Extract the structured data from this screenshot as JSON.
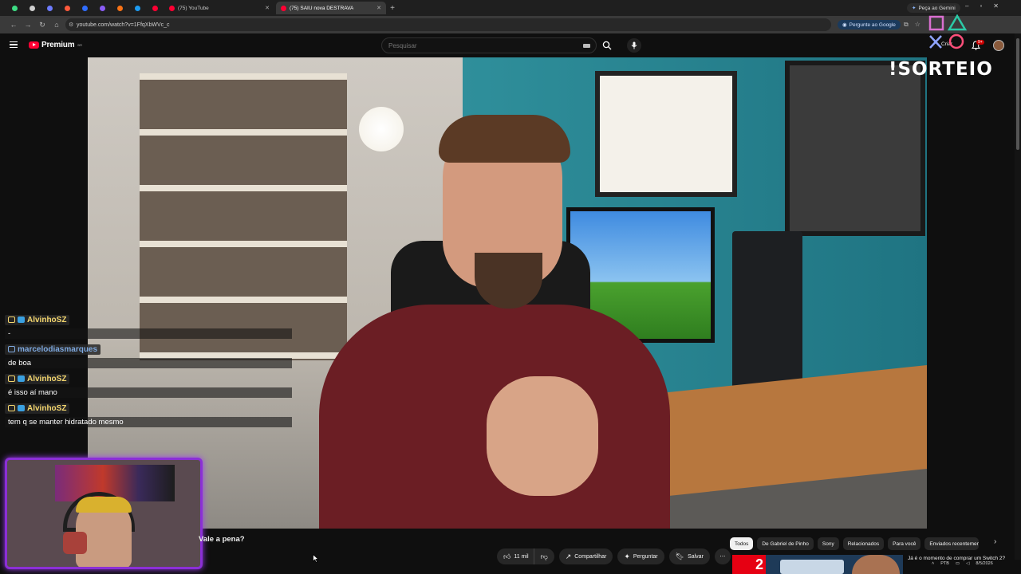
{
  "browser": {
    "tabs": [
      {
        "label": "",
        "color": "#3ddc84"
      },
      {
        "label": "",
        "color": "#cfcfcf"
      },
      {
        "label": "",
        "color": "#6d7cff"
      },
      {
        "label": "",
        "color": "#ff5a3c"
      },
      {
        "label": "",
        "color": "#2f6dff"
      },
      {
        "label": "",
        "color": "#8b5cf6"
      },
      {
        "label": "",
        "color": "#f97316"
      },
      {
        "label": "",
        "color": "#1d9bf0"
      },
      {
        "label": "",
        "color": "#ff0033"
      },
      {
        "label": "(75) YouTube",
        "color": "#ff0033"
      },
      {
        "label": "(75) SAIU nova DESTRAVA",
        "color": "#ff0033",
        "active": true
      }
    ],
    "gemini_label": "Peça ao Gemini",
    "url": "youtube.com/watch?v=1FfqXbWVc_c",
    "ask_google_label": "Pergunte ao Google"
  },
  "youtube": {
    "logo_text": "Premium",
    "logo_sup": "BR",
    "search_placeholder": "Pesquisar",
    "create_label": "Criar",
    "notifications_count": "9+"
  },
  "overlay": {
    "sorteio_text": "!SORTEIO"
  },
  "chat": [
    {
      "user": "AlvinhoSZ",
      "color": "#f5d76e",
      "message": "-"
    },
    {
      "user": "marcelodiasmarques",
      "color": "#7ea9e0",
      "message": "de boa"
    },
    {
      "user": "AlvinhoSZ",
      "color": "#f5d76e",
      "message": "é isso aí mano"
    },
    {
      "user": "AlvinhoSZ",
      "color": "#f5d76e",
      "message": "tem q se manter hidratado mesmo"
    }
  ],
  "video": {
    "title": "Vale a pena?",
    "likes": "11 mil",
    "share_label": "Compartilhar",
    "ask_label": "Perguntar",
    "save_label": "Salvar"
  },
  "chips": [
    {
      "label": "Todos",
      "selected": true
    },
    {
      "label": "De Gabriel de Pinho"
    },
    {
      "label": "Sony"
    },
    {
      "label": "Relacionados"
    },
    {
      "label": "Para você"
    },
    {
      "label": "Enviados recentemente"
    }
  ],
  "recommendation": {
    "title": "Já é o momento de comprar um Switch 2?",
    "thumb_text": "2"
  },
  "tray": {
    "lang": "PTB",
    "date": "8/5/2026"
  }
}
